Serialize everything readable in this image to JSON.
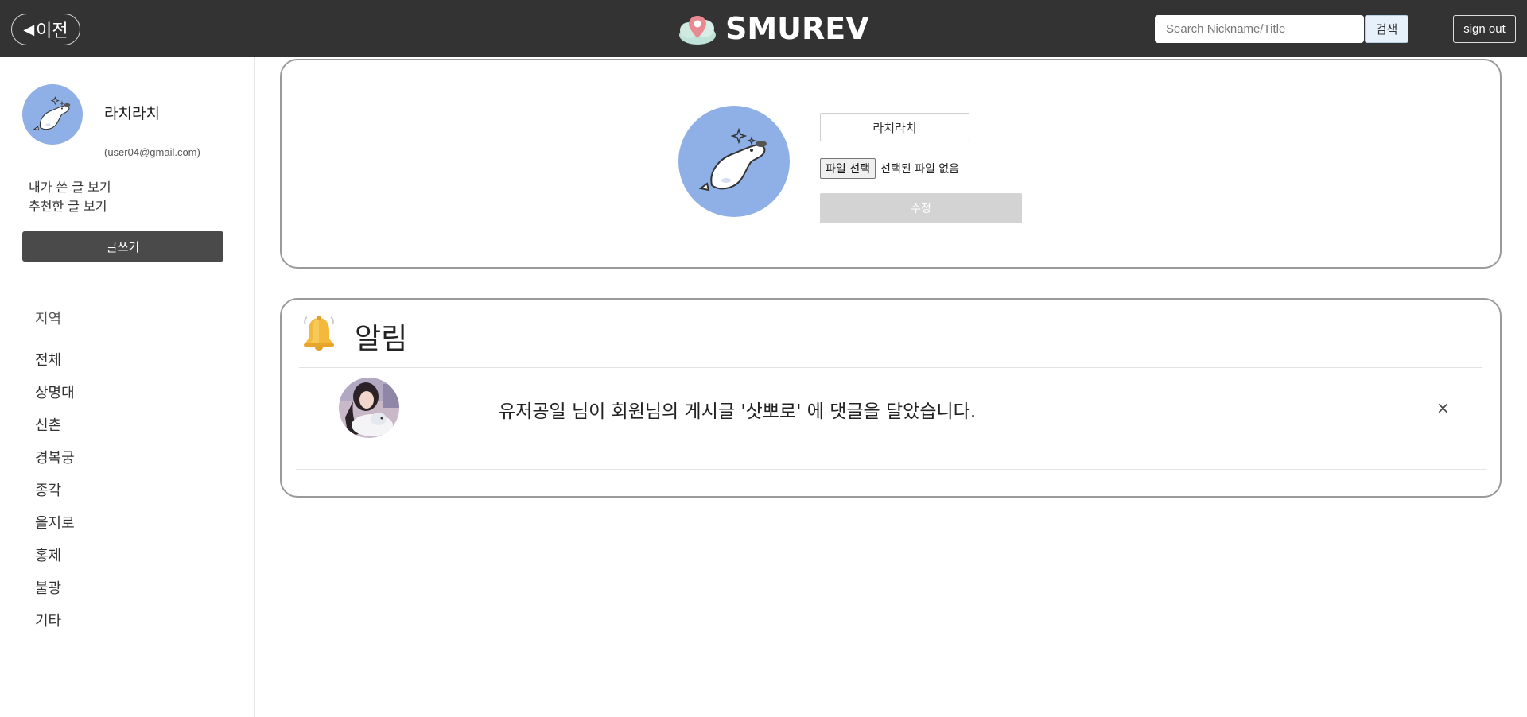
{
  "header": {
    "back_label": "이전",
    "logo_text": "SMUREV",
    "search_placeholder": "Search Nickname/Title",
    "search_button": "검색",
    "signout_button": "sign out"
  },
  "sidebar": {
    "nickname": "라치라치",
    "email": "(user04@gmail.com)",
    "links": [
      "내가 쓴 글 보기",
      "추천한 글 보기"
    ],
    "write_button": "글쓰기",
    "region_title": "지역",
    "regions": [
      "전체",
      "상명대",
      "신촌",
      "경복궁",
      "종각",
      "을지로",
      "홍제",
      "불광",
      "기타"
    ]
  },
  "profile": {
    "nickname_value": "라치라치",
    "file_button": "파일 선택",
    "file_status": "선택된 파일 없음",
    "edit_button": "수정"
  },
  "notifications": {
    "title": "알림",
    "items": [
      {
        "message": "유저공일 님이 회원님의 게시글 '삿뽀로' 에 댓글을 달았습니다.",
        "close": "×"
      }
    ]
  },
  "colors": {
    "header_bg": "#333333",
    "avatar_bg": "#8fb0e6",
    "write_button_bg": "#4a4a4a",
    "edit_button_bg": "#d3d3d3",
    "card_border": "#9a9a9a"
  }
}
